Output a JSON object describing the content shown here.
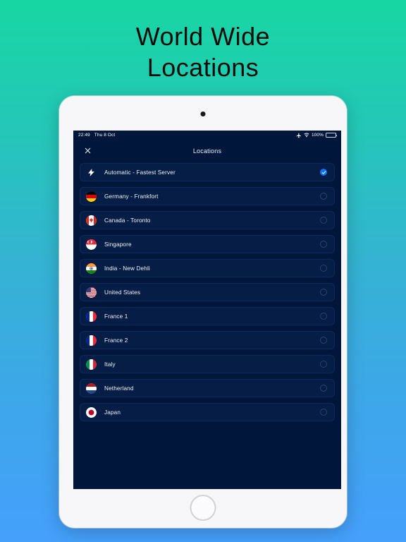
{
  "poster": {
    "line1": "World Wide",
    "line2": "Locations",
    "background_top": "#18d6a3",
    "background_bottom": "#45a0fc",
    "text_color": "#0b0b0b"
  },
  "device": {
    "type": "tablet",
    "bezel_color": "#f7f7f9"
  },
  "status_bar": {
    "time": "22:49",
    "date": "Thu 8 Oct",
    "airplane_icon": "airplane-icon",
    "wifi_icon": "wifi-icon",
    "battery_percent": "100%",
    "battery_fill_color": "#2fd760"
  },
  "nav": {
    "close_icon": "close-icon",
    "title": "Locations"
  },
  "theme": {
    "screen_background": "#00173b",
    "row_background": "#061d45",
    "row_border": "#0e2a58",
    "accent": "#1470f0",
    "label_color": "#f0f3f8"
  },
  "locations": [
    {
      "label": "Automatic - Fastest Server",
      "icon": "bolt-icon",
      "flag": "bolt",
      "selected": true
    },
    {
      "label": "Germany - Frankfort",
      "icon": "flag-germany-icon",
      "flag": "germany",
      "selected": false
    },
    {
      "label": "Canada - Toronto",
      "icon": "flag-canada-icon",
      "flag": "canada",
      "selected": false
    },
    {
      "label": "Singapore",
      "icon": "flag-singapore-icon",
      "flag": "singapore",
      "selected": false
    },
    {
      "label": "India - New Dehli",
      "icon": "flag-india-icon",
      "flag": "india",
      "selected": false
    },
    {
      "label": "United States",
      "icon": "flag-usa-icon",
      "flag": "usa",
      "selected": false
    },
    {
      "label": "France 1",
      "icon": "flag-france-icon",
      "flag": "france",
      "selected": false
    },
    {
      "label": "France 2",
      "icon": "flag-france-icon",
      "flag": "france",
      "selected": false
    },
    {
      "label": "Italy",
      "icon": "flag-italy-icon",
      "flag": "italy",
      "selected": false
    },
    {
      "label": "Netherland",
      "icon": "flag-netherlands-icon",
      "flag": "netherlands",
      "selected": false
    },
    {
      "label": "Japan",
      "icon": "flag-japan-icon",
      "flag": "japan",
      "selected": false
    }
  ]
}
